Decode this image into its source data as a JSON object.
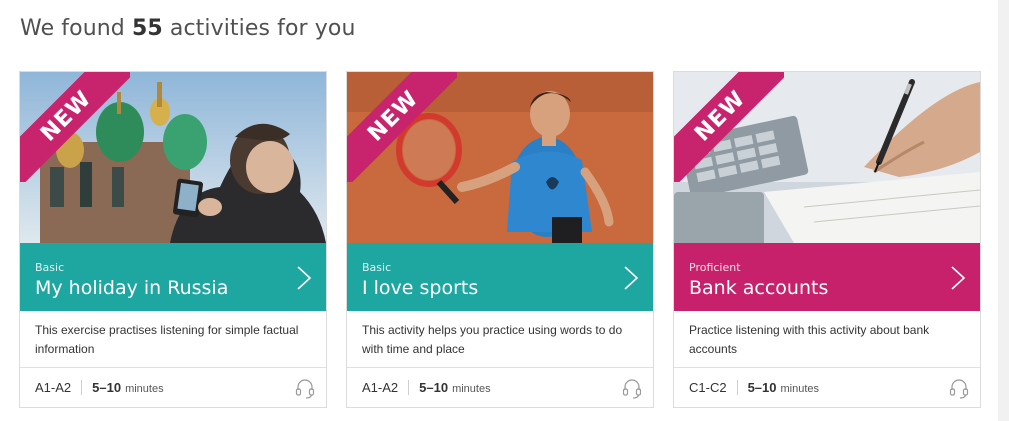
{
  "heading": {
    "prefix": "We found ",
    "count": "55",
    "suffix": " activities for you"
  },
  "ribbon_label": "NEW",
  "cards": [
    {
      "level": "Basic",
      "title": "My holiday in Russia",
      "description": "This exercise practises listening for simple factual information",
      "cefr": "A1-A2",
      "duration": "5–10",
      "unit": "minutes",
      "band_color": "#1ea6a1",
      "icon": "headphones-icon"
    },
    {
      "level": "Basic",
      "title": "I love sports",
      "description": "This activity helps you practice using words to do with time and place",
      "cefr": "A1-A2",
      "duration": "5–10",
      "unit": "minutes",
      "band_color": "#1ea6a1",
      "icon": "headphones-icon"
    },
    {
      "level": "Proficient",
      "title": "Bank accounts",
      "description": "Practice listening with this activity about bank accounts",
      "cefr": "C1-C2",
      "duration": "5–10",
      "unit": "minutes",
      "band_color": "#c8216b",
      "icon": "headphones-icon"
    }
  ],
  "colors": {
    "ribbon": "#c8246d",
    "teal": "#1ea6a1",
    "magenta": "#c8216b"
  }
}
